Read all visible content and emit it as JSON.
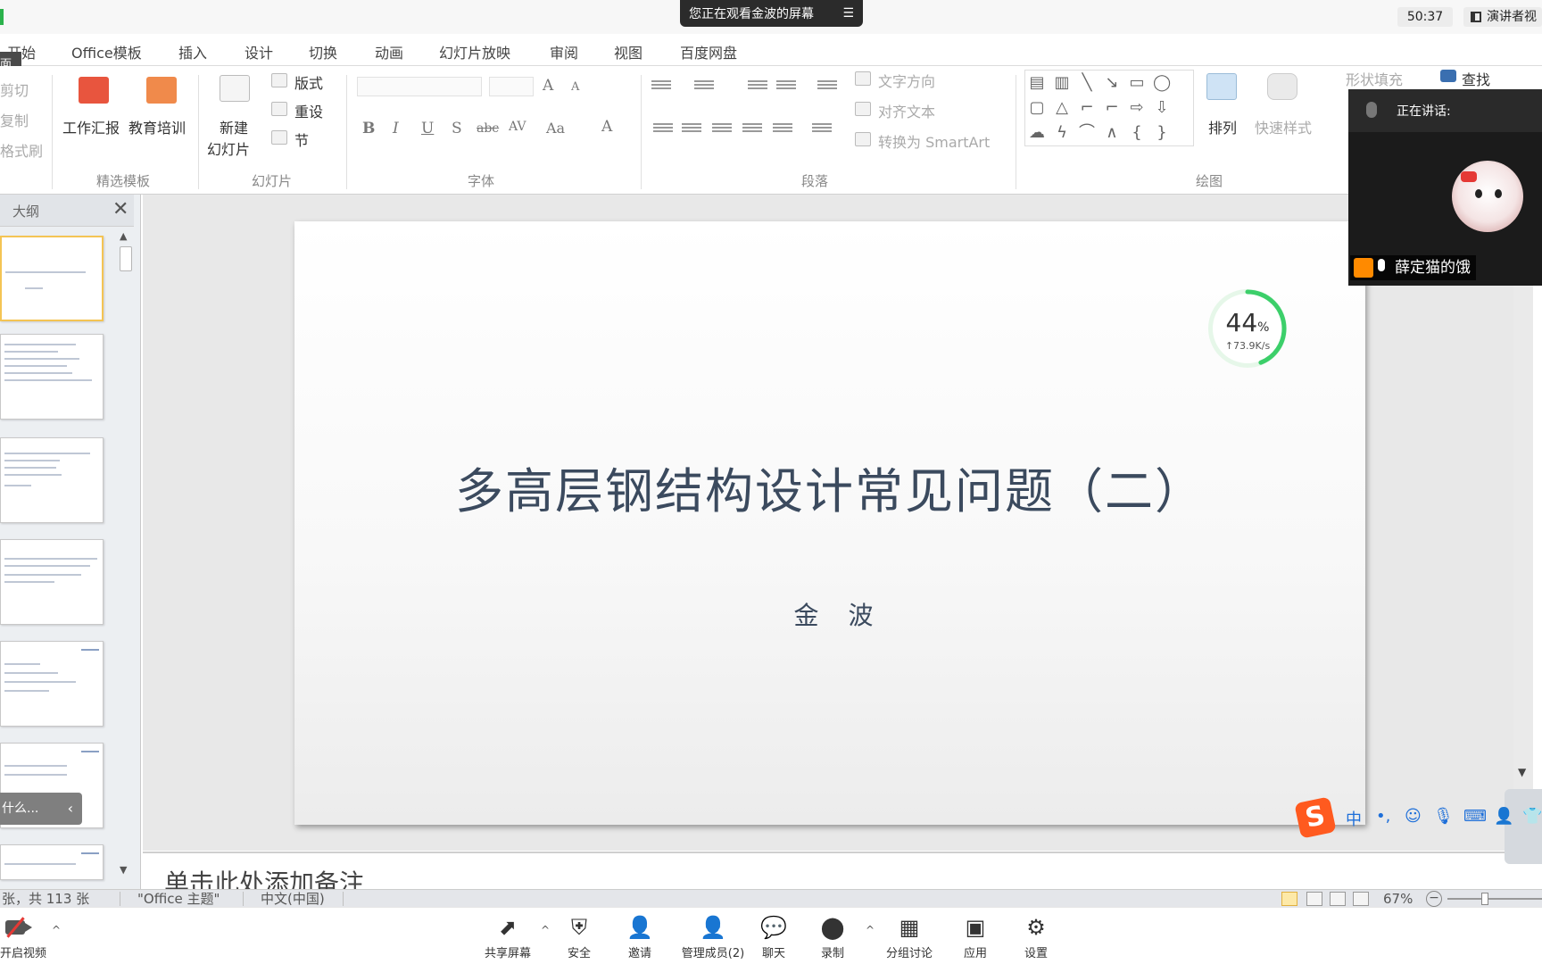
{
  "meeting": {
    "viewing_banner": "您正在观看金波的屏幕",
    "clock": "50:37",
    "speaker_view_label": "演讲者视",
    "speaking_label": "正在讲话:",
    "speaker_name": "薛定猫的饿"
  },
  "ribbon": {
    "home_tab_stub": "面",
    "tabs": [
      "开始",
      "Office模板",
      "插入",
      "设计",
      "切换",
      "动画",
      "幻灯片放映",
      "审阅",
      "视图",
      "百度网盘"
    ],
    "clipboard": {
      "cut": "剪切",
      "copy": "复制",
      "format_painter": "格式刷"
    },
    "templates": {
      "work_report": "工作汇报",
      "education": "教育培训",
      "group": "精选模板"
    },
    "slides": {
      "new_slide_line1": "新建",
      "new_slide_line2": "幻灯片",
      "layout": "版式",
      "reset": "重设",
      "section": "节",
      "group": "幻灯片"
    },
    "font": {
      "group": "字体"
    },
    "paragraph": {
      "text_direction": "文字方向",
      "align_text": "对齐文本",
      "smartart": "转换为 SmartArt",
      "group": "段落"
    },
    "drawing": {
      "arrange": "排列",
      "quick_styles": "快速样式",
      "shape_fill": "形状填充",
      "find": "查找",
      "group": "绘图"
    }
  },
  "outline": {
    "tab_label": "大纲",
    "slide_count": 7
  },
  "slide": {
    "title": "多高层钢结构设计常见问题（二）",
    "author": "金 波"
  },
  "net": {
    "percent": "44",
    "percent_unit": "%",
    "speed": "↑73.9K/s",
    "progress": 0.44
  },
  "search_float": {
    "label": "什么...",
    "chevron": "‹"
  },
  "notes": {
    "placeholder": "单击此处添加备注"
  },
  "status": {
    "slide_info": "张，共 113 张",
    "theme": "\"Office 主题\"",
    "language": "中文(中国)",
    "zoom": "67%"
  },
  "toolbar": {
    "camera": "开启视频",
    "share": "共享屏幕",
    "security": "安全",
    "invite": "邀请",
    "members": "管理成员(2)",
    "chat": "聊天",
    "record": "录制",
    "breakout": "分组讨论",
    "apps": "应用",
    "settings": "设置"
  },
  "ime": {
    "lang": "中",
    "punct": "•,"
  }
}
